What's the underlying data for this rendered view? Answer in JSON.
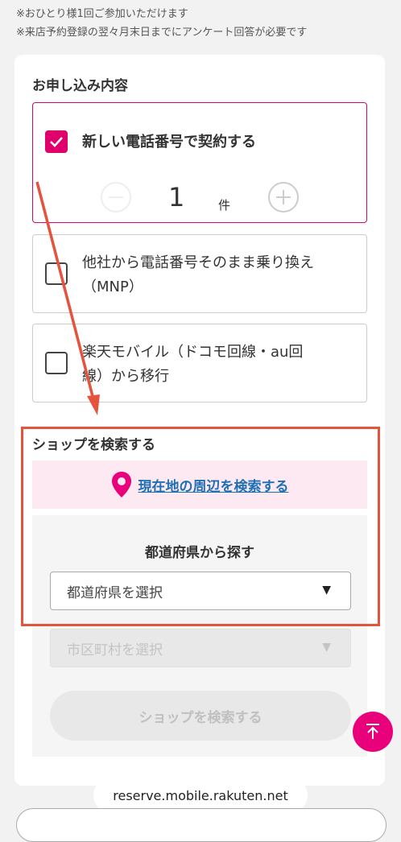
{
  "notes": [
    "※おひとり様1回ご参加いただけます",
    "※来店予約登録の翌々月末日までにアンケート回答が必要です"
  ],
  "application": {
    "title": "お申し込み内容",
    "options": [
      {
        "label": "新しい電話番号で契約する",
        "checked": true
      },
      {
        "label_line1": "他社から電話番号そのまま乗り換え",
        "label_line2": "（MNP）",
        "checked": false
      },
      {
        "label_line1": "楽天モバイル（ドコモ回線・au回",
        "label_line2": "線）から移行",
        "checked": false
      }
    ],
    "quantity": "1",
    "unit": "件"
  },
  "shop": {
    "title": "ショップを検索する",
    "nearby_link": "現在地の周辺を検索する",
    "prefecture_heading": "都道府県から探す",
    "prefecture_placeholder": "都道府県を選択",
    "city_placeholder": "市区町村を選択",
    "search_button": "ショップを検索する"
  },
  "browser": {
    "url": "reserve.mobile.rakuten.net"
  },
  "colors": {
    "accent": "#e0006c",
    "link": "#1f6fb5",
    "annotation": "#e5533d"
  },
  "icons": {
    "check": "check-icon",
    "minus": "minus-circle-icon",
    "plus": "plus-circle-icon",
    "pin": "map-pin-icon",
    "dropdown": "triangle-down-icon",
    "top": "arrow-up-icon"
  }
}
